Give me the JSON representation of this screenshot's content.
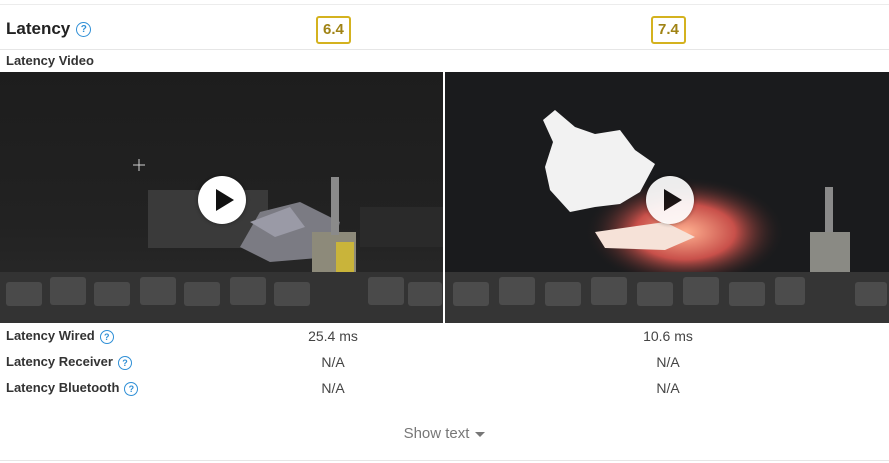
{
  "section": {
    "title": "Latency",
    "scores": [
      "6.4",
      "7.4"
    ]
  },
  "video_row": {
    "label": "Latency Video"
  },
  "metrics": [
    {
      "label": "Latency Wired",
      "values": [
        "25.4 ms",
        "10.6 ms"
      ]
    },
    {
      "label": "Latency Receiver",
      "values": [
        "N/A",
        "N/A"
      ]
    },
    {
      "label": "Latency Bluetooth",
      "values": [
        "N/A",
        "N/A"
      ]
    }
  ],
  "show_text": {
    "label": "Show text"
  },
  "colors": {
    "help_icon": "#2f8fd6",
    "score_border": "#d4b21f",
    "score_text": "#a08315"
  }
}
